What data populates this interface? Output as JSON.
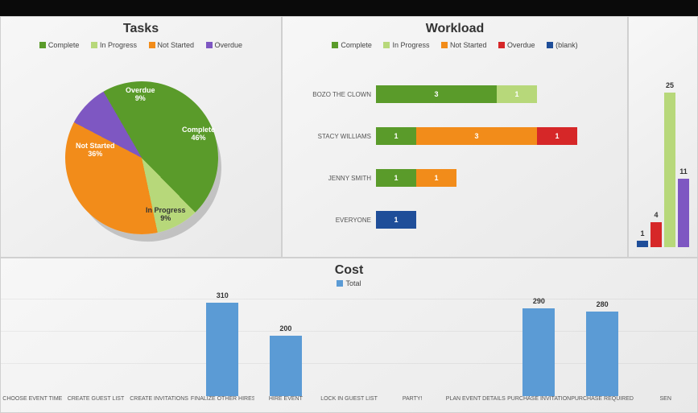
{
  "chart_data": [
    {
      "id": "tasks",
      "type": "pie",
      "title": "Tasks",
      "legend": [
        "Complete",
        "In Progress",
        "Not Started",
        "Overdue"
      ],
      "slices": [
        {
          "name": "Complete",
          "pct": 46,
          "color": "#5a9b2a"
        },
        {
          "name": "In Progress",
          "pct": 9,
          "color": "#b7d87a"
        },
        {
          "name": "Not Started",
          "pct": 36,
          "color": "#f28c1a"
        },
        {
          "name": "Overdue",
          "pct": 9,
          "color": "#7e57c2"
        }
      ]
    },
    {
      "id": "workload",
      "type": "bar",
      "orientation": "horizontal",
      "stacked": true,
      "title": "Workload",
      "legend": [
        "Complete",
        "In Progress",
        "Not Started",
        "Overdue",
        "(blank)"
      ],
      "colors": {
        "Complete": "#5a9b2a",
        "In Progress": "#b7d87a",
        "Not Started": "#f28c1a",
        "Overdue": "#d62728",
        "(blank)": "#1f4e99"
      },
      "categories": [
        "BOZO THE CLOWN",
        "STACY WILLIAMS",
        "JENNY SMITH",
        "EVERYONE"
      ],
      "series": [
        {
          "name": "Complete",
          "values": [
            3,
            1,
            1,
            0
          ]
        },
        {
          "name": "In Progress",
          "values": [
            1,
            0,
            0,
            0
          ]
        },
        {
          "name": "Not Started",
          "values": [
            0,
            3,
            1,
            0
          ]
        },
        {
          "name": "Overdue",
          "values": [
            0,
            1,
            0,
            0
          ]
        },
        {
          "name": "(blank)",
          "values": [
            0,
            0,
            0,
            1
          ]
        }
      ],
      "xlim": [
        0,
        6
      ]
    },
    {
      "id": "side",
      "type": "bar",
      "title": "",
      "categories": [
        "",
        "",
        "",
        ""
      ],
      "values": [
        1,
        4,
        25,
        11
      ],
      "colors": [
        "#1f4e99",
        "#d62728",
        "#b7d87a",
        "#7e57c2"
      ],
      "ylim": [
        0,
        26
      ]
    },
    {
      "id": "cost",
      "type": "bar",
      "title": "Cost",
      "legend": [
        "Total"
      ],
      "categories": [
        "CHOOSE EVENT TIME",
        "CREATE GUEST LIST",
        "CREATE INVITATIONS",
        "FINALIZE OTHER HIRES",
        "HIRE EVENT",
        "LOCK IN GUEST LIST",
        "PARTY!",
        "PLAN EVENT DETAILS",
        "PURCHASE INVITATION",
        "PURCHASE REQUIRED",
        "SEN"
      ],
      "values": [
        0,
        0,
        0,
        310,
        200,
        0,
        0,
        0,
        290,
        280,
        0
      ],
      "ylim": [
        0,
        320
      ],
      "color": "#5b9bd5"
    }
  ],
  "labels": {
    "tasks_title": "Tasks",
    "workload_title": "Workload",
    "cost_title": "Cost",
    "lg_complete": "Complete",
    "lg_progress": "In Progress",
    "lg_notstarted": "Not Started",
    "lg_overdue": "Overdue",
    "lg_blank": "(blank)",
    "lg_total": "Total",
    "pie_complete_name": "Complete",
    "pie_complete_pct": "46%",
    "pie_progress_name": "In Progress",
    "pie_progress_pct": "9%",
    "pie_notstarted_name": "Not Started",
    "pie_notstarted_pct": "36%",
    "pie_overdue_name": "Overdue",
    "pie_overdue_pct": "9%"
  }
}
